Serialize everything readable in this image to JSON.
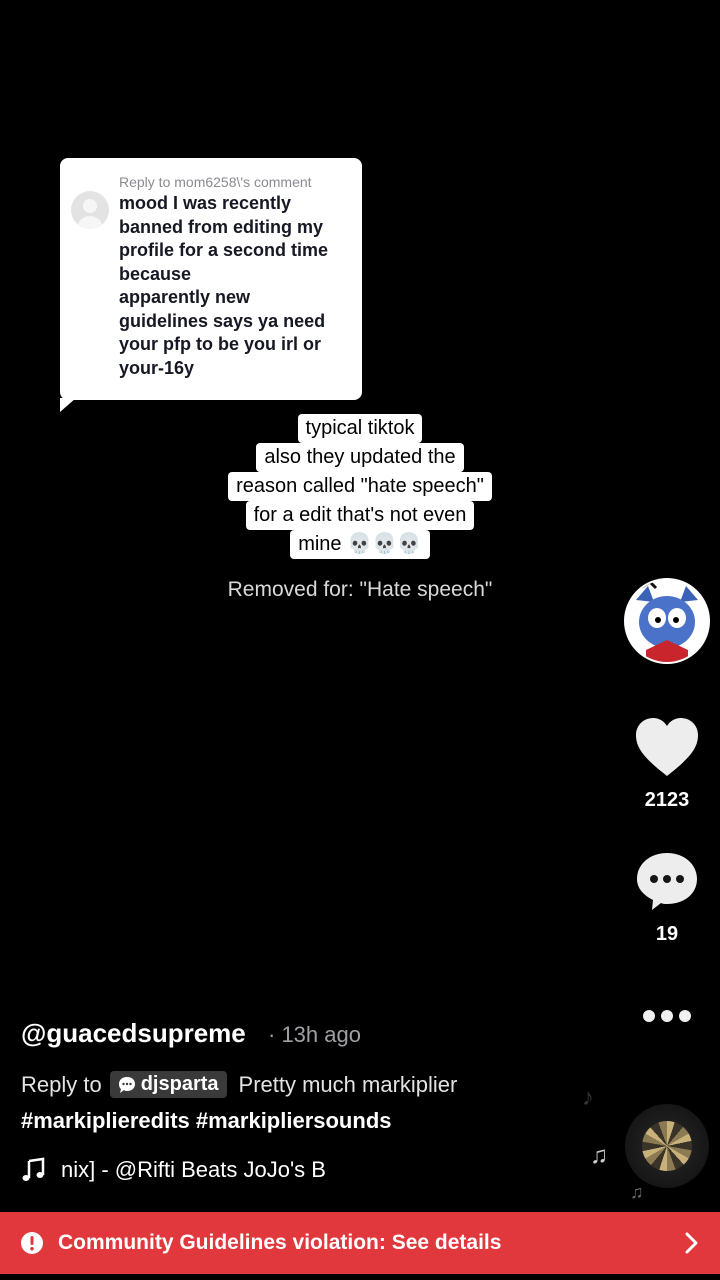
{
  "reply_comment": {
    "header": "Reply to mom6258\\'s comment",
    "text": "mood I was recently\nbanned from editing my\nprofile for a second time\nbecause\napparently new\nguidelines says ya need\nyour pfp to be you irl or\nyour-16y"
  },
  "caption_lines": [
    "typical tiktok",
    "also they updated the",
    "reason called \"hate speech\"",
    "for a edit that's not even",
    "mine 💀💀💀"
  ],
  "removed_notice": "Removed for: \"Hate speech\"",
  "actions": {
    "likes": "2123",
    "comments": "19"
  },
  "post": {
    "author": "@guacedsupreme",
    "time": "· 13h ago",
    "reply_prefix": "Reply to",
    "reply_user": "djsparta",
    "description": "Pretty much markiplier",
    "hashtags": "#markiplieredits #markipliersounds",
    "music": "nix] - @Rifti Beats    JoJo's B"
  },
  "violation_banner": {
    "text": "Community Guidelines violation: See details",
    "color": "#e0383c"
  },
  "icons": {
    "like": "heart-icon",
    "comment": "comment-bubble-icon",
    "more": "more-dots-icon",
    "music": "music-note-icon",
    "alert": "alert-circle-icon",
    "chevron": "chevron-right-icon"
  }
}
